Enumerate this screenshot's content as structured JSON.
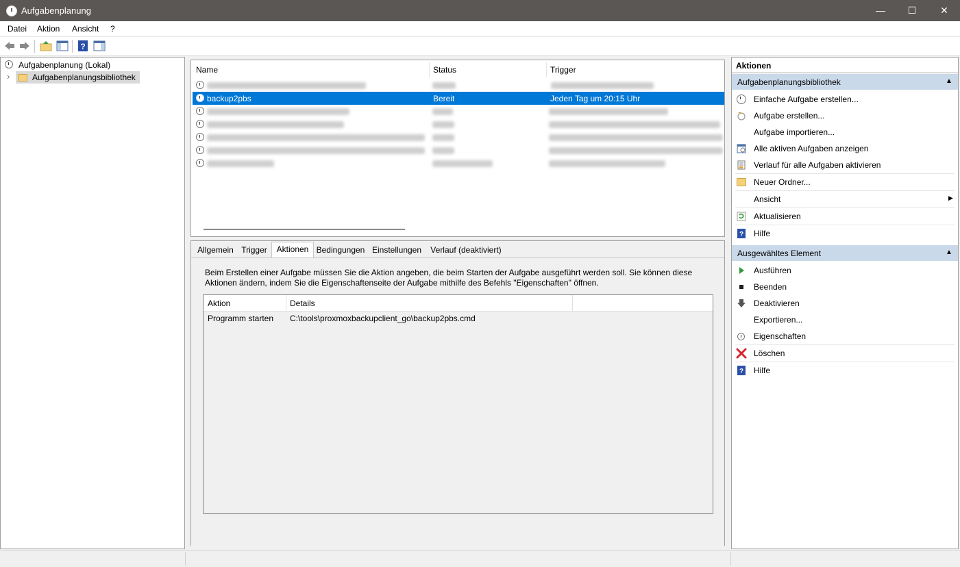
{
  "window": {
    "title": "Aufgabenplanung",
    "minimize": "—",
    "maximize": "☐",
    "close": "✕"
  },
  "menu": [
    "Datei",
    "Aktion",
    "Ansicht",
    "?"
  ],
  "tree": {
    "root": "Aufgabenplanung (Lokal)",
    "child": "Aufgabenplanungsbibliothek",
    "expander": "›"
  },
  "tasklist": {
    "columns": [
      "Name",
      "Status",
      "Trigger"
    ],
    "selected": {
      "name": "backup2pbs",
      "status": "Bereit",
      "trigger": "Jeden Tag um 20:15 Uhr"
    }
  },
  "details": {
    "tabs": [
      "Allgemein",
      "Trigger",
      "Aktionen",
      "Bedingungen",
      "Einstellungen",
      "Verlauf (deaktiviert)"
    ],
    "active_tab": "Aktionen",
    "description_line1": "Beim Erstellen einer Aufgabe müssen Sie die Aktion angeben, die beim Starten der Aufgabe ausgeführt werden soll. Sie können diese",
    "description_line2": "Aktionen ändern, indem Sie die Eigenschaftenseite der Aufgabe mithilfe des Befehls \"Eigenschaften\" öffnen.",
    "table_columns": [
      "Aktion",
      "Details"
    ],
    "table_row": {
      "action": "Programm starten",
      "details": "C:\\tools\\proxmoxbackupclient_go\\backup2pbs.cmd"
    }
  },
  "actions_pane": {
    "header": "Aktionen",
    "section1": "Aufgabenplanungsbibliothek",
    "section1_items": [
      "Einfache Aufgabe erstellen...",
      "Aufgabe erstellen...",
      "Aufgabe importieren...",
      "Alle aktiven Aufgaben anzeigen",
      "Verlauf für alle Aufgaben aktivieren",
      "Neuer Ordner...",
      "Ansicht",
      "Aktualisieren",
      "Hilfe"
    ],
    "section2": "Ausgewähltes Element",
    "section2_items": [
      "Ausführen",
      "Beenden",
      "Deaktivieren",
      "Exportieren...",
      "Eigenschaften",
      "Löschen",
      "Hilfe"
    ],
    "collapse_glyph": "▲",
    "submenu_glyph": "▶"
  },
  "colors": {
    "selection": "#0078d7",
    "section_header": "#c9d9ea",
    "titlebar": "#5b5754"
  }
}
